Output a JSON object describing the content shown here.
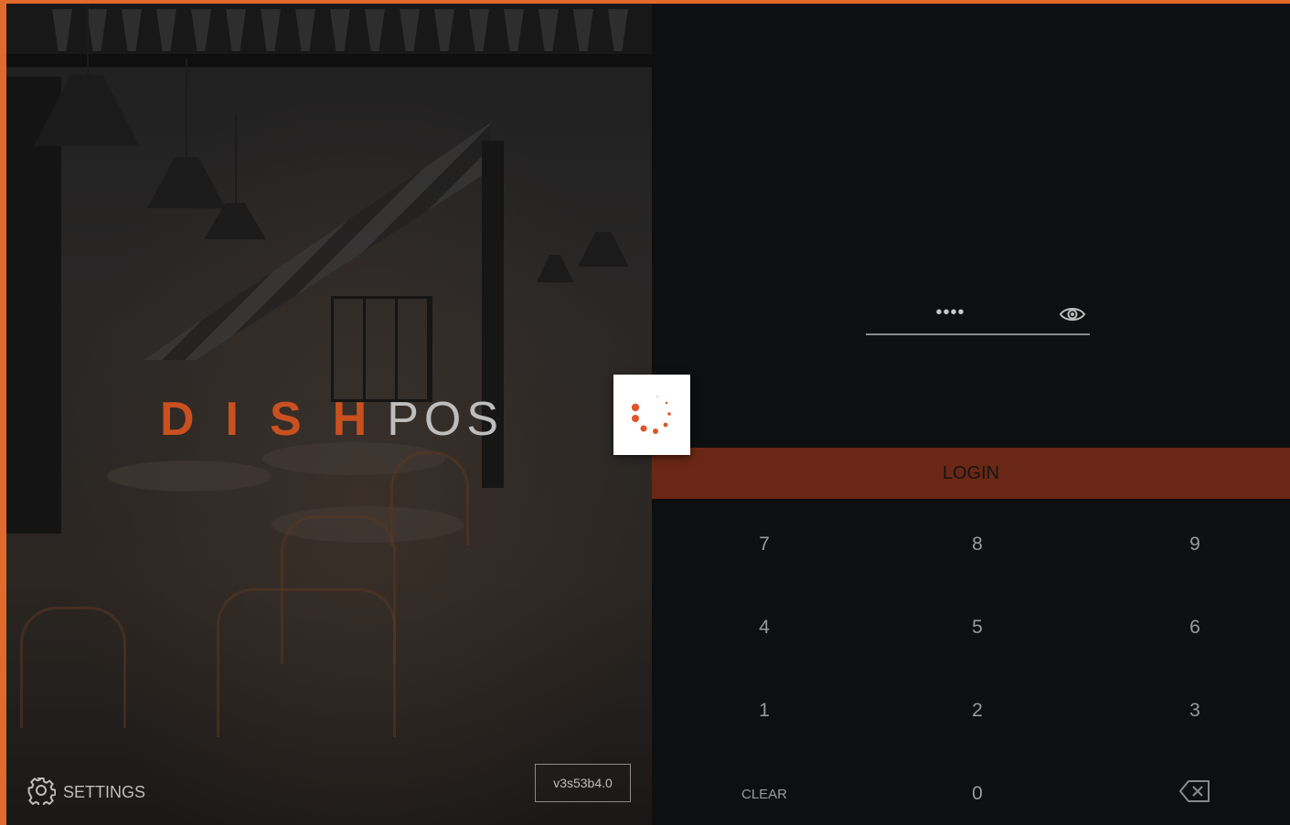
{
  "brand": {
    "dish": "DISH",
    "pos": "POS",
    "accent": "#c9501f",
    "frame_color": "#e06a2c"
  },
  "settings": {
    "icon": "gear-icon",
    "label": "SETTINGS"
  },
  "version": "v3s53b4.0",
  "loading": {
    "icon": "spinner-icon"
  },
  "pin": {
    "value": "••••",
    "visibility_icon": "eye-icon"
  },
  "login": {
    "label": "LOGIN",
    "color": "#6b2715"
  },
  "keypad": {
    "rows": [
      [
        "7",
        "8",
        "9"
      ],
      [
        "4",
        "5",
        "6"
      ],
      [
        "1",
        "2",
        "3"
      ]
    ],
    "clear": "CLEAR",
    "zero": "0",
    "backspace_icon": "backspace-icon"
  }
}
